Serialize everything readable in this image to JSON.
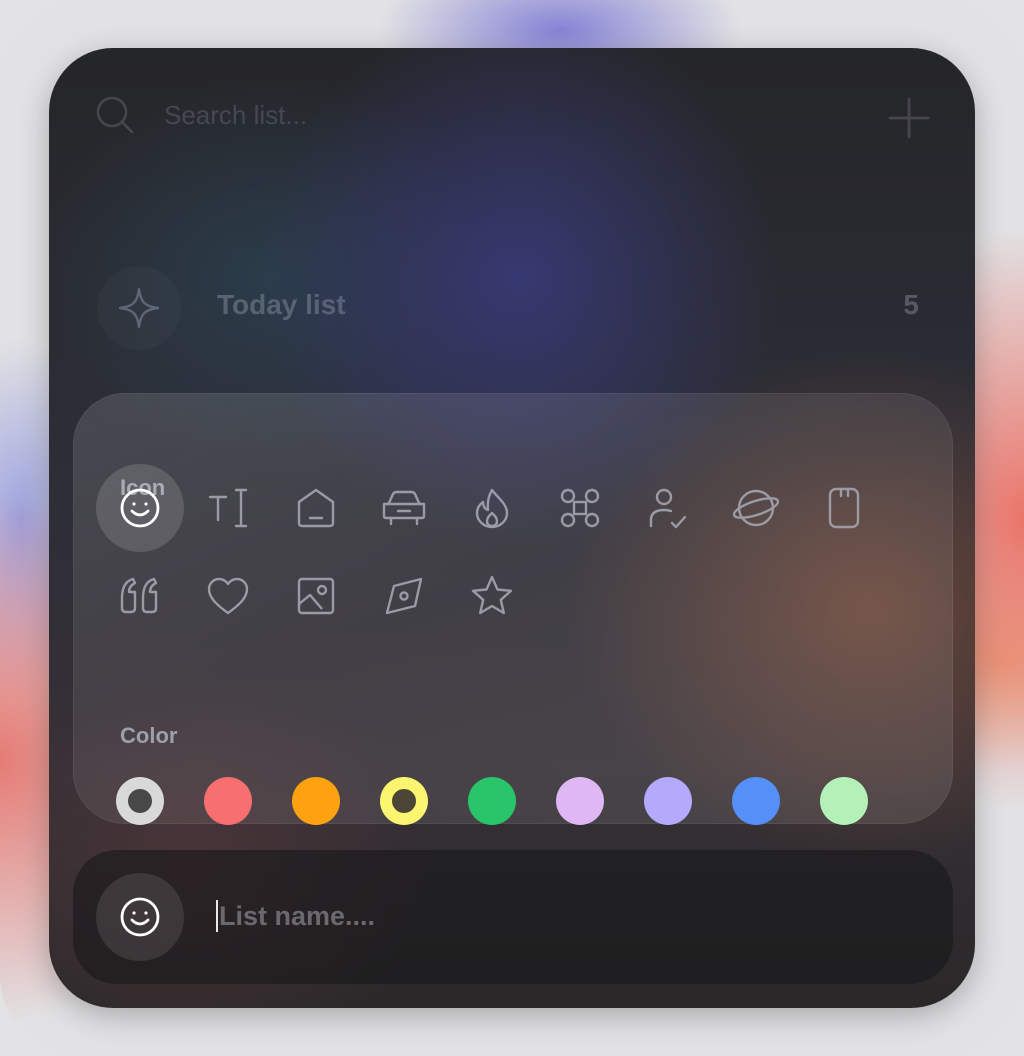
{
  "search": {
    "placeholder": "Search list..."
  },
  "today": {
    "label": "Today list",
    "count": "5"
  },
  "picker": {
    "icon_label": "Icon",
    "color_label": "Color",
    "icons": [
      "smiley",
      "text",
      "home",
      "car",
      "flame",
      "command",
      "user-check",
      "planet",
      "sd-card",
      "quote",
      "heart",
      "image",
      "compass",
      "star"
    ],
    "selected_icon": "smiley",
    "colors": [
      {
        "hex": "#d9d9da",
        "selected": true
      },
      {
        "hex": "#f86f6f",
        "selected": false
      },
      {
        "hex": "#ffa20f",
        "selected": false
      },
      {
        "hex": "#fbf56f",
        "selected": true
      },
      {
        "hex": "#2ac46b",
        "selected": false
      },
      {
        "hex": "#dfb7f5",
        "selected": false
      },
      {
        "hex": "#b4aafb",
        "selected": false
      },
      {
        "hex": "#558ff8",
        "selected": false
      },
      {
        "hex": "#b3f1b8",
        "selected": false
      }
    ]
  },
  "input": {
    "placeholder": "List name....",
    "value": "",
    "icon": "smiley"
  }
}
